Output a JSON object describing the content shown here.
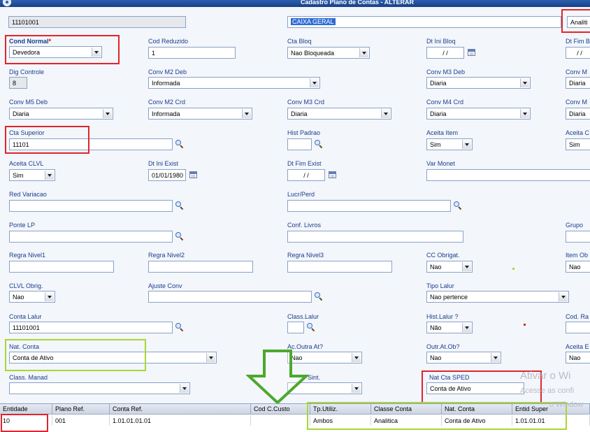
{
  "window": {
    "title": "Cadastro Plano de Contas - ALTERAR"
  },
  "fields": {
    "conta": "11101001",
    "descricao": "CAIXA GERAL",
    "classe": "Analiti",
    "cond_normal_label": "Cond Normal",
    "cond_normal_required": "*",
    "cond_normal": "Devedora",
    "cod_reduzido_label": "Cod Reduzido",
    "cod_reduzido": "1",
    "cta_bloq_label": "Cta Bloq",
    "cta_bloq": "Nao Bloqueada",
    "dt_ini_bloq_label": "Dt Ini Bloq",
    "dt_ini_bloq": "/ /",
    "dt_fim_b_label": "Dt Fim B",
    "dt_fim_b": "/ /",
    "dig_controle_label": "Dig Controle",
    "dig_controle": "8",
    "conv_m2_deb_label": "Conv M2 Deb",
    "conv_m2_deb": "Informada",
    "conv_m3_deb_label": "Conv M3 Deb",
    "conv_m3_deb": "Diaria",
    "conv_m_r1_label": "Conv M",
    "conv_m_r1": "Diaria",
    "conv_m5_deb_label": "Conv M5 Deb",
    "conv_m5_deb": "Diaria",
    "conv_m2_crd_label": "Conv M2 Crd",
    "conv_m2_crd": "Informada",
    "conv_m3_crd_label": "Conv M3 Crd",
    "conv_m3_crd": "Diaria",
    "conv_m4_crd_label": "Conv M4 Crd",
    "conv_m4_crd": "Diaria",
    "conv_m_r2_label": "Conv M",
    "conv_m_r2": "Diaria",
    "cta_superior_label": "Cta Superior",
    "cta_superior": "11101",
    "hist_padrao_label": "Hist Padrao",
    "aceita_item_label": "Aceita Item",
    "aceita_item": "Sim",
    "aceita_c_label": "Aceita C",
    "aceita_c": "Sim",
    "aceita_clvl_label": "Aceita CLVL",
    "aceita_clvl": "Sim",
    "dt_ini_exist_label": "Dt Ini Exist",
    "dt_ini_exist": "01/01/1980",
    "dt_fim_exist_label": "Dt Fim Exist",
    "dt_fim_exist": "/ /",
    "var_monet_label": "Var Monet",
    "red_variacao_label": "Red Variacao",
    "lucr_perd_label": "Lucr/Perd",
    "ponte_lp_label": "Ponte LP",
    "conf_livros_label": "Conf. Livros",
    "grupo_label": "Grupo",
    "regra_nivel1_label": "Regra Nivel1",
    "regra_nivel2_label": "Regra Nivel2",
    "regra_nivel3_label": "Regra Nivel3",
    "cc_obrigat_label": "CC Obrigat.",
    "cc_obrigat": "Nao",
    "item_ob_label": "Item Ob",
    "item_ob": "Nao",
    "clvl_obrig_label": "CLVL Obrig.",
    "clvl_obrig": "Nao",
    "ajuste_conv_label": "Ajuste Conv",
    "tipo_lalur_label": "Tipo Lalur",
    "tipo_lalur": "Nao pertence",
    "conta_lalur_label": "Conta Lalur",
    "conta_lalur": "11101001",
    "class_lalur_label": "Class.Lalur",
    "hist_lalur_label": "Hist.Lalur ?",
    "hist_lalur": "Não",
    "cod_ra_label": "Cod. Ra",
    "nat_conta_label": "Nat. Conta",
    "nat_conta": "Conta de Ativo",
    "ac_outra_at_label": "Ac.Outra At?",
    "ac_outra_at": "Nao",
    "outr_at_ob_label": "Outr.At.Ob?",
    "outr_at_ob": "Nao",
    "aceita_e_label": "Aceita E",
    "aceita_e": "Nao",
    "class_manad_label": "Class. Manad",
    "sint_label": "Sint.",
    "nat_cta_sped_label": "Nat Cta SPED",
    "nat_cta_sped": "Conta de Ativo"
  },
  "grid": {
    "headers": [
      "Entidade",
      "Plano Ref.",
      "Conta Ref.",
      "Cod C.Custo",
      "Tp.Utiliz.",
      "Classe Conta",
      "Nat. Conta",
      "Entid Super"
    ],
    "row": [
      "10",
      "001",
      "1.01.01.01.01",
      "",
      "Ambos",
      "Analitica",
      "Conta de Ativo",
      "1.01.01.01"
    ]
  },
  "watermark": {
    "line1": "Ativar o Wi",
    "line2": "Acesse as confi",
    "line3": "o Window"
  },
  "colors": {
    "highlight_red": "#e2242c",
    "highlight_green": "#a9d636",
    "label": "#1b3d8f"
  }
}
